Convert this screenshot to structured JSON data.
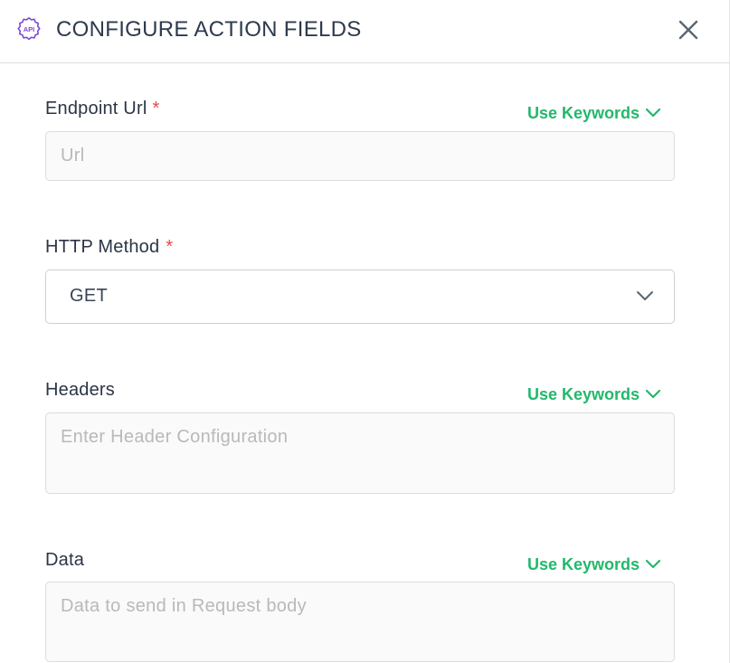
{
  "header": {
    "icon": "api-gear-icon",
    "title": "CONFIGURE ACTION FIELDS",
    "close": "close-icon"
  },
  "fields": {
    "endpoint": {
      "label": "Endpoint Url",
      "required_mark": "*",
      "keywords_label": "Use Keywords",
      "placeholder": "Url"
    },
    "method": {
      "label": "HTTP Method",
      "required_mark": "*",
      "selected": "GET"
    },
    "headers": {
      "label": "Headers",
      "keywords_label": "Use Keywords",
      "placeholder": "Enter Header Configuration"
    },
    "data": {
      "label": "Data",
      "keywords_label": "Use Keywords",
      "placeholder": "Data to send in Request body"
    }
  },
  "icon_text": "API",
  "colors": {
    "accent_green": "#22b86a",
    "required_red": "#e5484d",
    "icon_purple": "#7b4ad6",
    "title": "#2e3a4d"
  }
}
